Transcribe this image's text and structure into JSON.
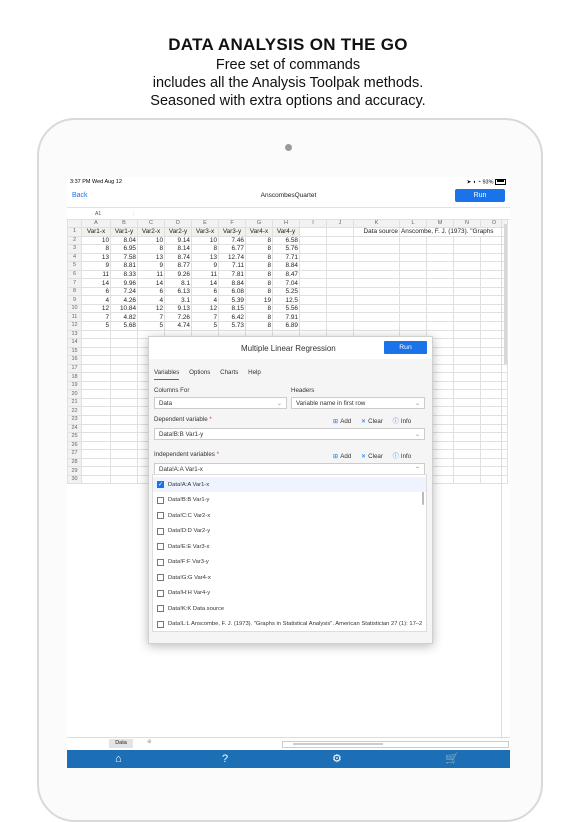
{
  "hero": {
    "title": "DATA ANALYSIS ON THE GO",
    "line1": "Free set of commands",
    "line2": "includes all the Analysis Toolpak methods.",
    "line3": "Seasoned with extra options and accuracy."
  },
  "status": {
    "time": "3:37 PM",
    "date": "Wed Aug 12",
    "battery": "93%"
  },
  "nav": {
    "back": "Back",
    "title": "AnscombesQuartet",
    "run": "Run"
  },
  "formula": {
    "cell_ref": "A1"
  },
  "grid": {
    "columns": [
      "A",
      "B",
      "C",
      "D",
      "E",
      "F",
      "G",
      "H",
      "I",
      "J",
      "K",
      "L",
      "M",
      "N",
      "O"
    ],
    "headers": [
      "Var1-x",
      "Var1-y",
      "Var2-x",
      "Var2-y",
      "Var3-x",
      "Var3-y",
      "Var4-x",
      "Var4-y"
    ],
    "rows": [
      [
        "10",
        "8.04",
        "10",
        "9.14",
        "10",
        "7.46",
        "8",
        "6.58"
      ],
      [
        "8",
        "6.95",
        "8",
        "8.14",
        "8",
        "6.77",
        "8",
        "5.76"
      ],
      [
        "13",
        "7.58",
        "13",
        "8.74",
        "13",
        "12.74",
        "8",
        "7.71"
      ],
      [
        "9",
        "8.81",
        "9",
        "8.77",
        "9",
        "7.11",
        "8",
        "8.84"
      ],
      [
        "11",
        "8.33",
        "11",
        "9.26",
        "11",
        "7.81",
        "8",
        "8.47"
      ],
      [
        "14",
        "9.96",
        "14",
        "8.1",
        "14",
        "8.84",
        "8",
        "7.04"
      ],
      [
        "6",
        "7.24",
        "6",
        "6.13",
        "6",
        "6.08",
        "8",
        "5.25"
      ],
      [
        "4",
        "4.26",
        "4",
        "3.1",
        "4",
        "5.39",
        "19",
        "12.5"
      ],
      [
        "12",
        "10.84",
        "12",
        "9.13",
        "12",
        "8.15",
        "8",
        "5.56"
      ],
      [
        "7",
        "4.82",
        "7",
        "7.26",
        "7",
        "6.42",
        "8",
        "7.91"
      ],
      [
        "5",
        "5.68",
        "5",
        "4.74",
        "5",
        "5.73",
        "8",
        "6.89"
      ]
    ],
    "k1": "Data source",
    "l1": "Anscombe, F. J. (1973). \"Graphs"
  },
  "dialog": {
    "title": "Multiple Linear Regression",
    "run": "Run",
    "tabs": [
      "Variables",
      "Options",
      "Charts",
      "Help"
    ],
    "columns_for_label": "Columns For",
    "columns_for_value": "Data",
    "headers_label": "Headers",
    "headers_value": "Variable name in first row",
    "dependent_label": "Dependent variable",
    "dependent_value": "Data!B:B Var1-y",
    "independent_label": "Independent variables",
    "independent_value": "Data!A:A Var1-x",
    "add": "Add",
    "clear": "Clear",
    "info": "Info",
    "items": [
      {
        "label": "Data!A:A Var1-x",
        "checked": true
      },
      {
        "label": "Data!B:B Var1-y",
        "checked": false
      },
      {
        "label": "Data!C:C Var2-x",
        "checked": false
      },
      {
        "label": "Data!D:D Var2-y",
        "checked": false
      },
      {
        "label": "Data!E:E Var3-x",
        "checked": false
      },
      {
        "label": "Data!F:F Var3-y",
        "checked": false
      },
      {
        "label": "Data!G:G Var4-x",
        "checked": false
      },
      {
        "label": "Data!H:H Var4-y",
        "checked": false
      },
      {
        "label": "Data!K:K Data source",
        "checked": false
      },
      {
        "label": "Data!L:L Anscombe, F. J. (1973). \"Graphs in Statistical Analysis\". American Statistician 27 (1): 17–2",
        "checked": false
      }
    ]
  },
  "sheet_tab": "Data",
  "toolbar_icons": [
    "home-icon",
    "help-icon",
    "gear-icon",
    "cart-icon"
  ]
}
